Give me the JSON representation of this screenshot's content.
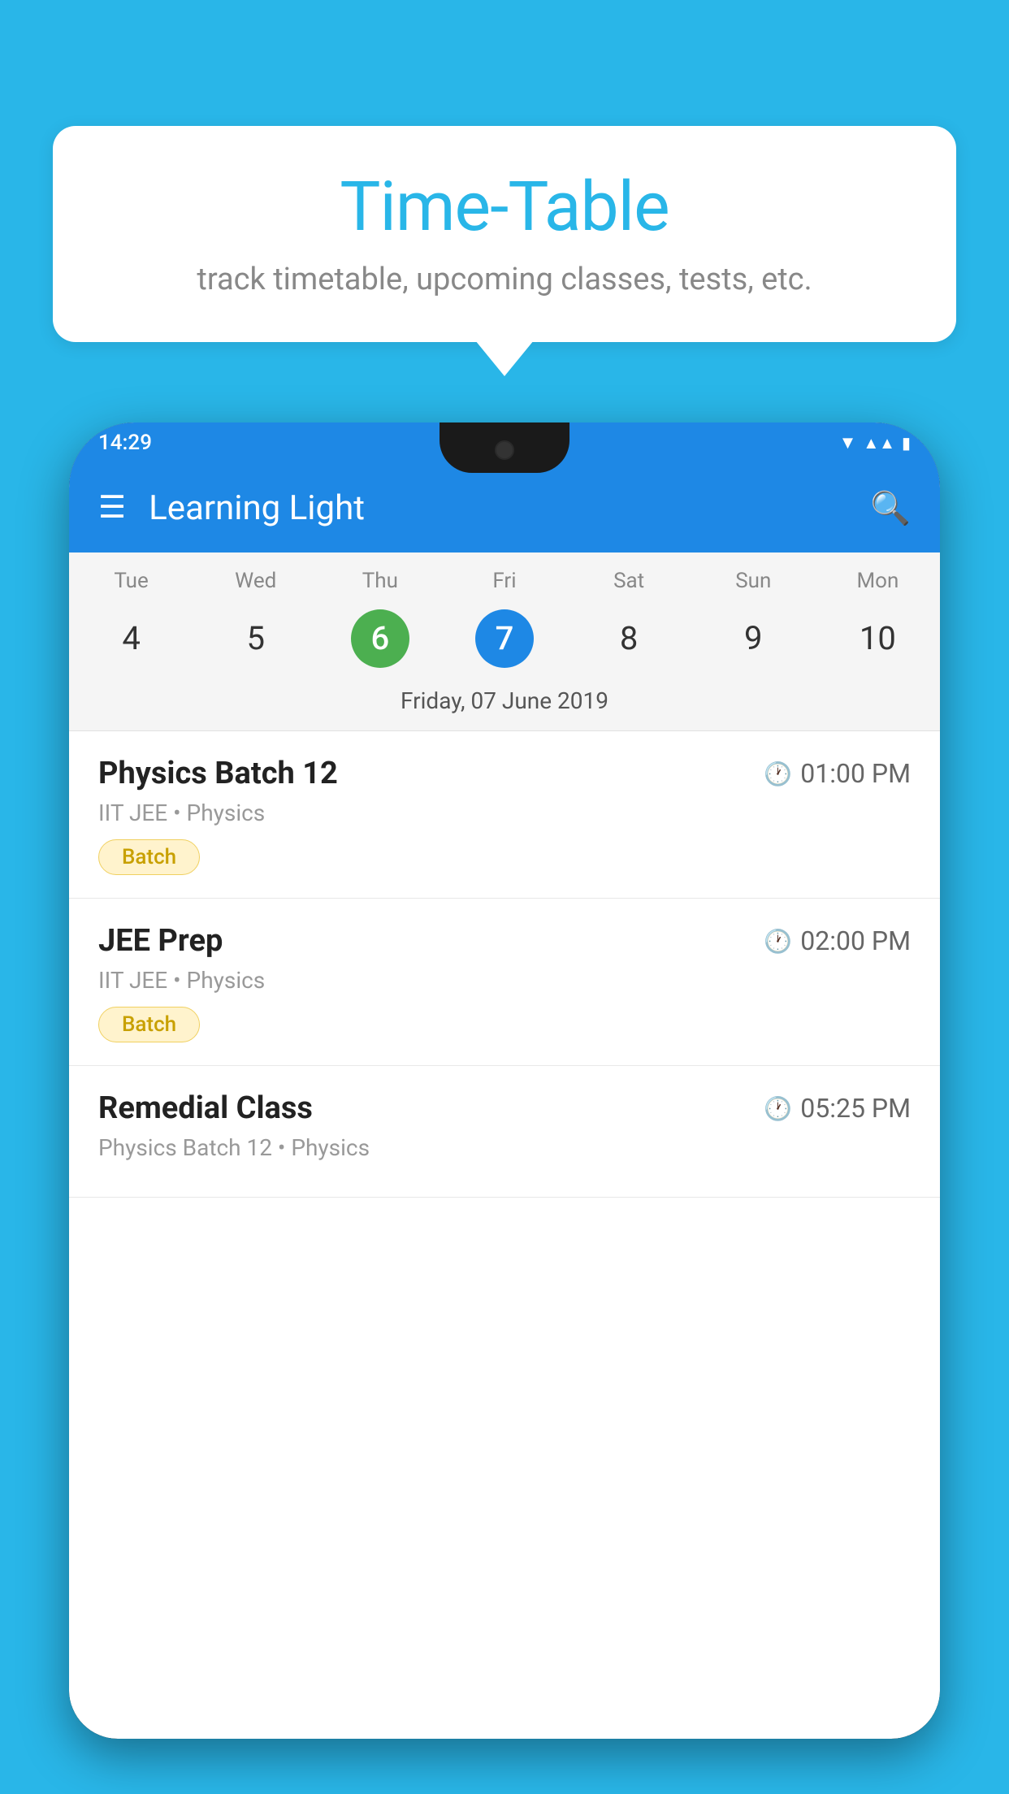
{
  "background_color": "#29b6e8",
  "speech_bubble": {
    "title": "Time-Table",
    "subtitle": "track timetable, upcoming classes, tests, etc."
  },
  "app": {
    "status_time": "14:29",
    "app_name": "Learning Light",
    "selected_date_label": "Friday, 07 June 2019"
  },
  "calendar": {
    "days": [
      "Tue",
      "Wed",
      "Thu",
      "Fri",
      "Sat",
      "Sun",
      "Mon"
    ],
    "dates": [
      "4",
      "5",
      "6",
      "7",
      "8",
      "9",
      "10"
    ],
    "today_index": 2,
    "selected_index": 3
  },
  "schedule": [
    {
      "title": "Physics Batch 12",
      "time": "01:00 PM",
      "meta": "IIT JEE • Physics",
      "badge": "Batch"
    },
    {
      "title": "JEE Prep",
      "time": "02:00 PM",
      "meta": "IIT JEE • Physics",
      "badge": "Batch"
    },
    {
      "title": "Remedial Class",
      "time": "05:25 PM",
      "meta": "Physics Batch 12 • Physics",
      "badge": ""
    }
  ],
  "icons": {
    "hamburger": "☰",
    "search": "🔍",
    "clock": "🕐",
    "wifi": "▼",
    "signal": "▲",
    "battery": "▮"
  }
}
